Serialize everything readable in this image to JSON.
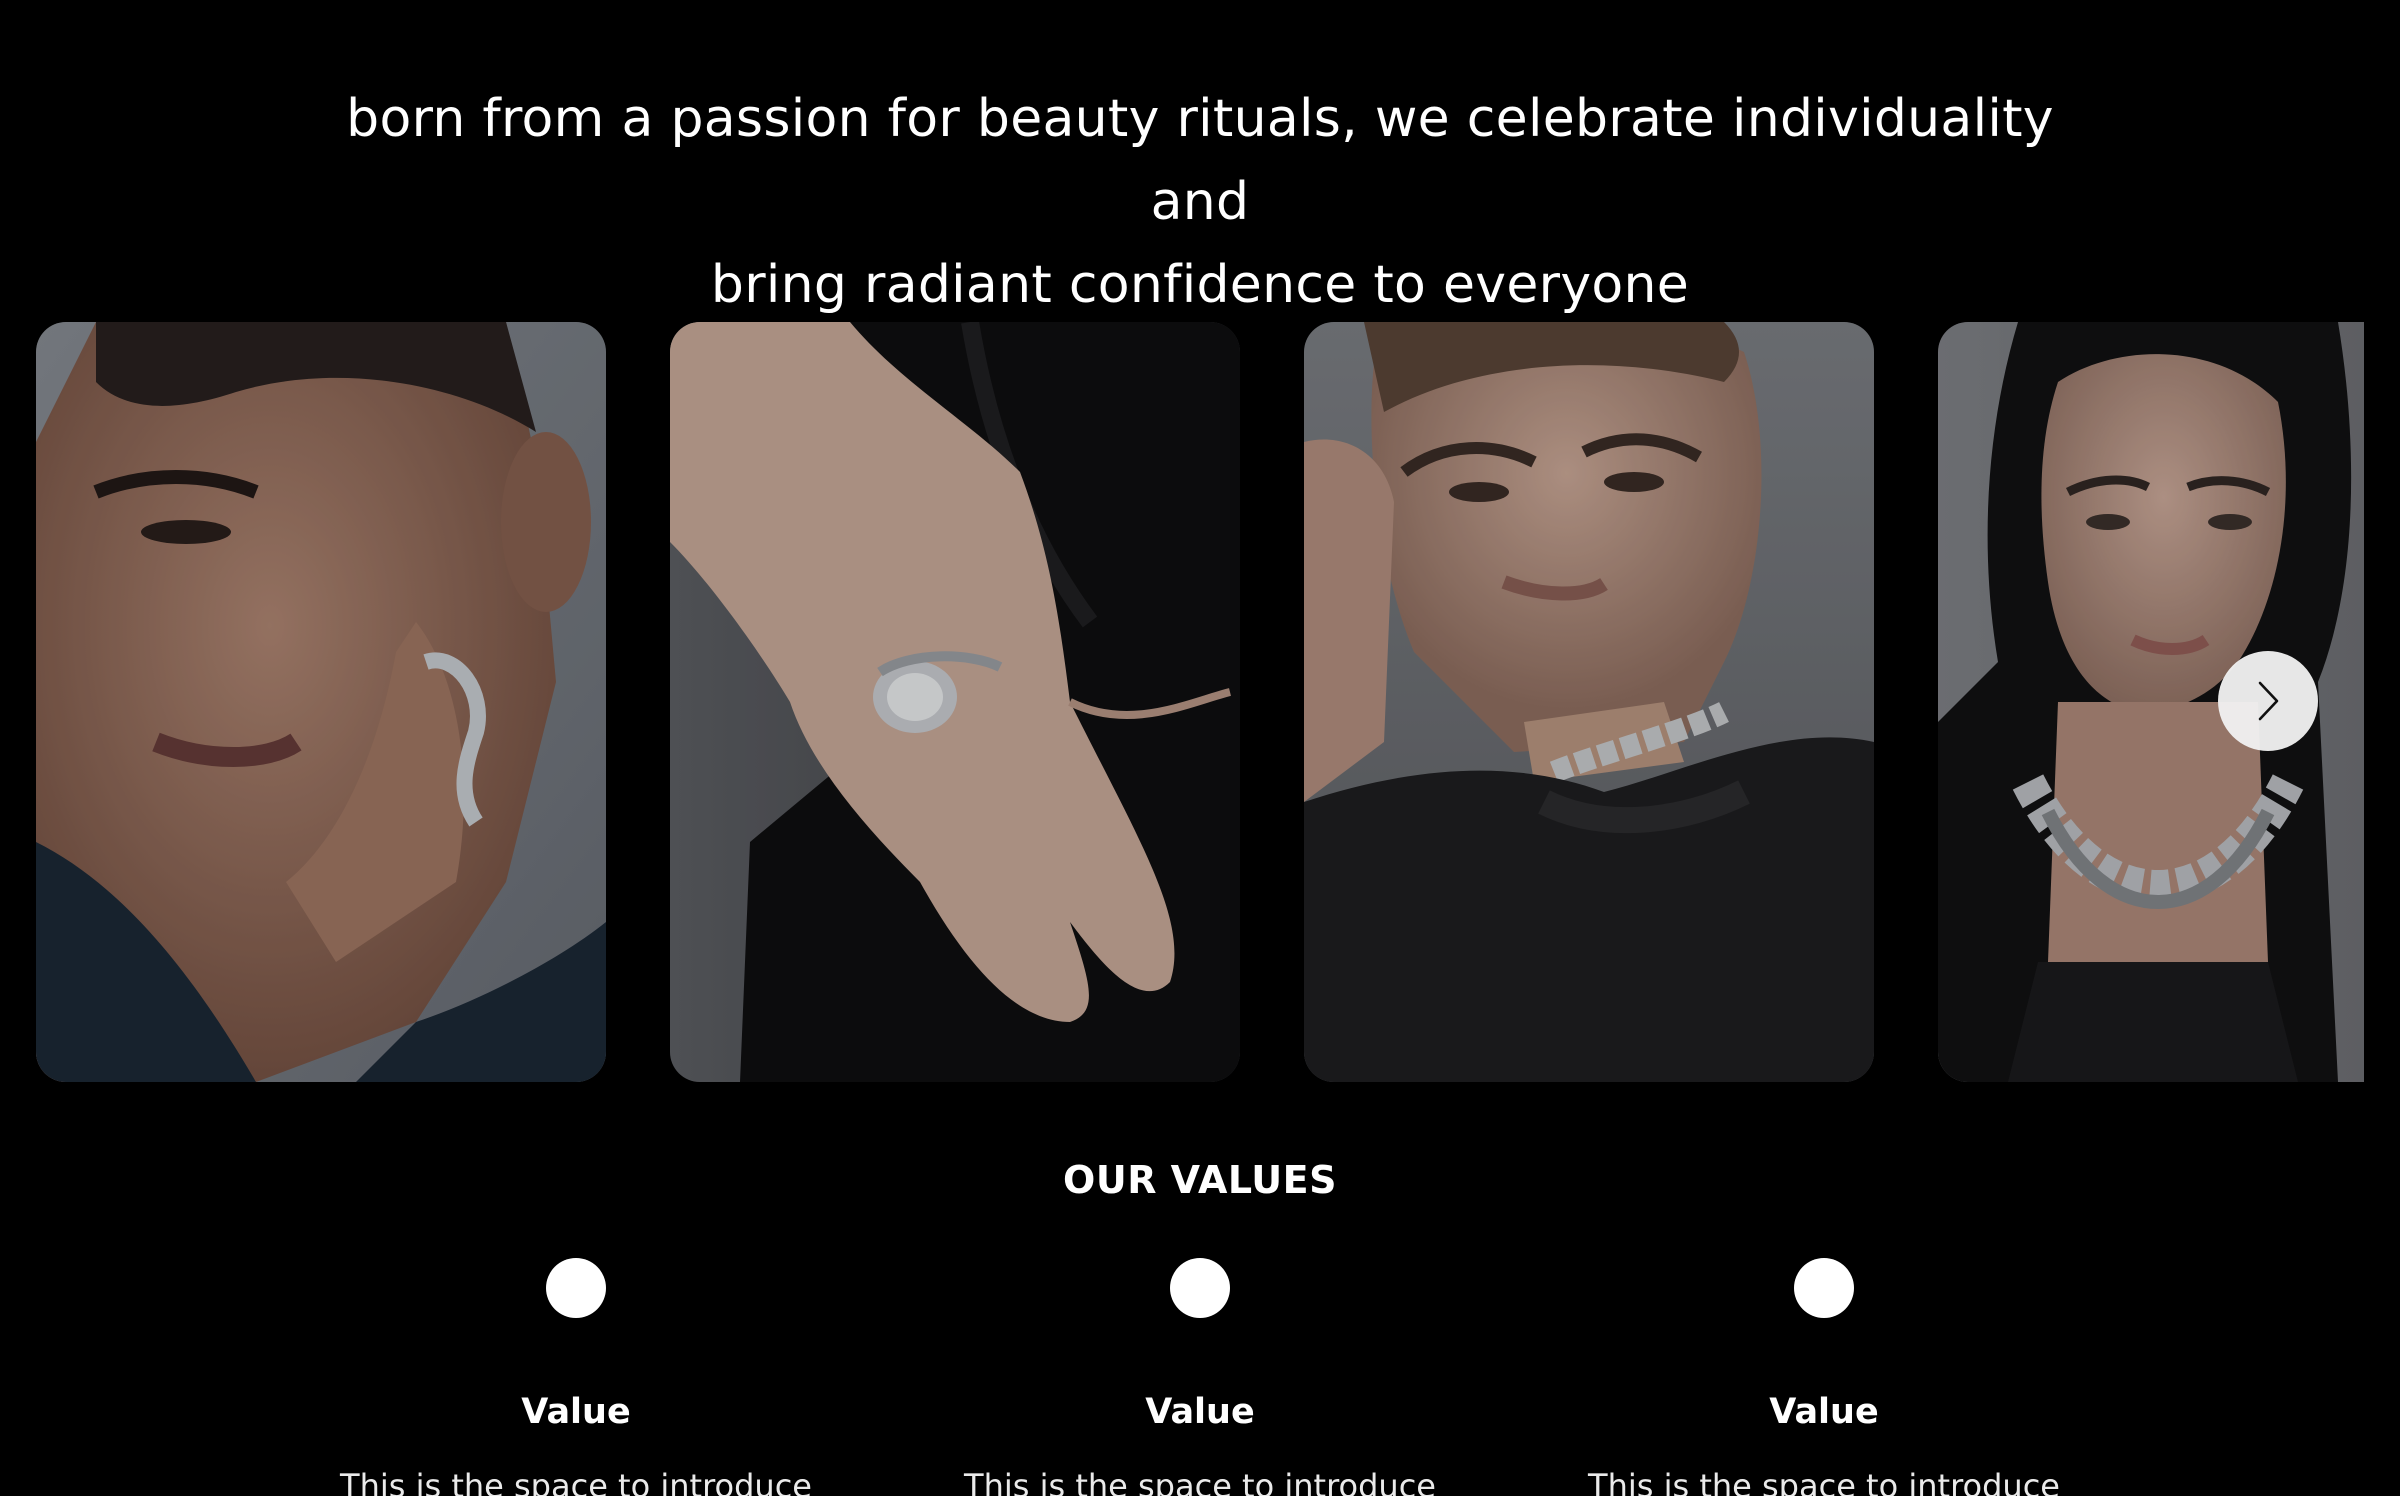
{
  "hero": {
    "tagline_line1": "born from a passion for beauty rituals, we celebrate individuality and",
    "tagline_line2": "bring radiant confidence to everyone"
  },
  "gallery": {
    "images": [
      {
        "description_icon": "model-with-finger-armor-ring"
      },
      {
        "description_icon": "hand-with-ring"
      },
      {
        "description_icon": "model-with-spiked-choker"
      },
      {
        "description_icon": "model-with-spiked-necklace"
      }
    ],
    "next_icon": "chevron-right-icon"
  },
  "values": {
    "title": "OUR VALUES",
    "items": [
      {
        "name": "Value",
        "description": "This is the space to introduce"
      },
      {
        "name": "Value",
        "description": "This is the space to introduce"
      },
      {
        "name": "Value",
        "description": "This is the space to introduce"
      }
    ]
  },
  "colors": {
    "background": "#000000",
    "text": "#ffffff",
    "button": "#f0f0f0"
  }
}
